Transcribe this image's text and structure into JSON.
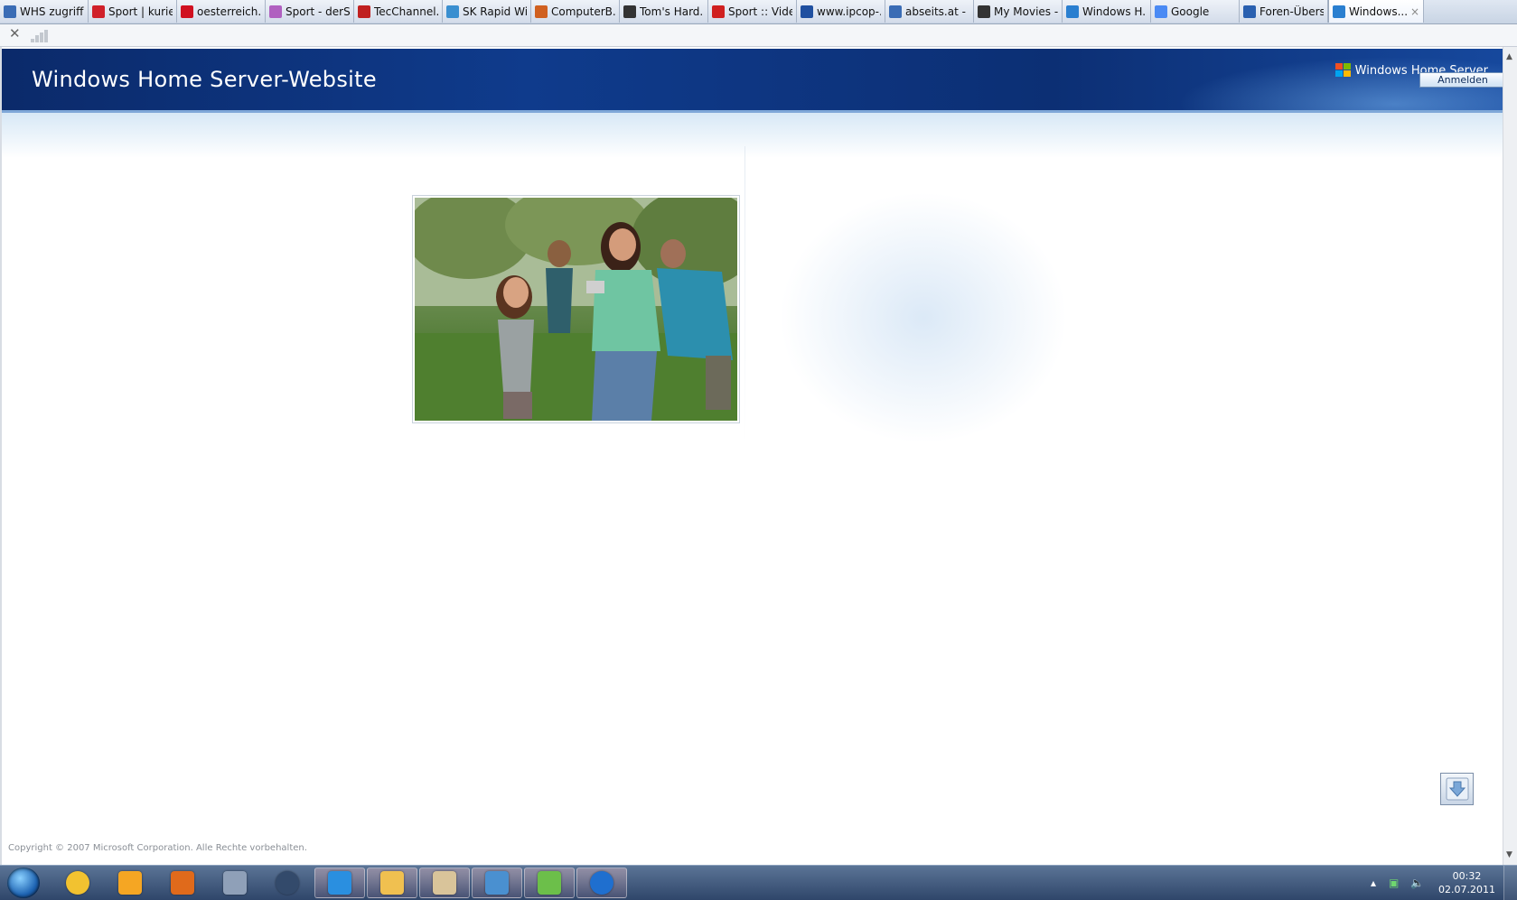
{
  "browser": {
    "tabs": [
      {
        "label": "WHS zugriff ...",
        "favicon": "page-icon",
        "color": "#3a6cb5"
      },
      {
        "label": "Sport | kurier...",
        "favicon": "kurier-icon",
        "color": "#d0202a"
      },
      {
        "label": "oesterreich....",
        "favicon": "target-icon",
        "color": "#d01020"
      },
      {
        "label": "Sport - derSt...",
        "favicon": "house-icon",
        "color": "#b060c0"
      },
      {
        "label": "TecChannel....",
        "favicon": "tec-icon",
        "color": "#c02020"
      },
      {
        "label": "SK Rapid Wi...",
        "favicon": "rapid-icon",
        "color": "#3a8fd0"
      },
      {
        "label": "ComputerB...",
        "favicon": "cb-icon",
        "color": "#d06020"
      },
      {
        "label": "Tom's Hard...",
        "favicon": "toms-icon",
        "color": "#333333"
      },
      {
        "label": "Sport :: Vide...",
        "favicon": "sport-icon",
        "color": "#d02020"
      },
      {
        "label": "www.ipcop-...",
        "favicon": "ip-icon",
        "color": "#2050a0"
      },
      {
        "label": "abseits.at - ...",
        "favicon": "abseits-icon",
        "color": "#3a6cb5"
      },
      {
        "label": "My Movies -...",
        "favicon": "movies-icon",
        "color": "#333333"
      },
      {
        "label": "Windows H...",
        "favicon": "ie-icon",
        "color": "#2a7fd0"
      },
      {
        "label": "Google",
        "favicon": "google-icon",
        "color": "#4a8af4"
      },
      {
        "label": "Foren-Übers...",
        "favicon": "forum-icon",
        "color": "#2a60b0"
      },
      {
        "label": "Windows...",
        "favicon": "ie-icon",
        "color": "#2a7fd0",
        "active": true
      }
    ],
    "close_glyph": "×"
  },
  "page": {
    "title": "Windows Home Server-Website",
    "brand": "Windows Home Server",
    "login_label": "Anmelden",
    "copyright": "Copyright © 2007 Microsoft Corporation. Alle Rechte vorbehalten."
  },
  "taskbar": {
    "clock_time": "00:32",
    "clock_date": "02.07.2011",
    "items": [
      "chrome-icon",
      "winamp-icon",
      "media-player-icon",
      "server-icon",
      "lock-icon",
      "ie-icon",
      "explorer-icon",
      "folder-icon",
      "remote-desktop-icon",
      "users-icon",
      "home-server-icon"
    ]
  }
}
